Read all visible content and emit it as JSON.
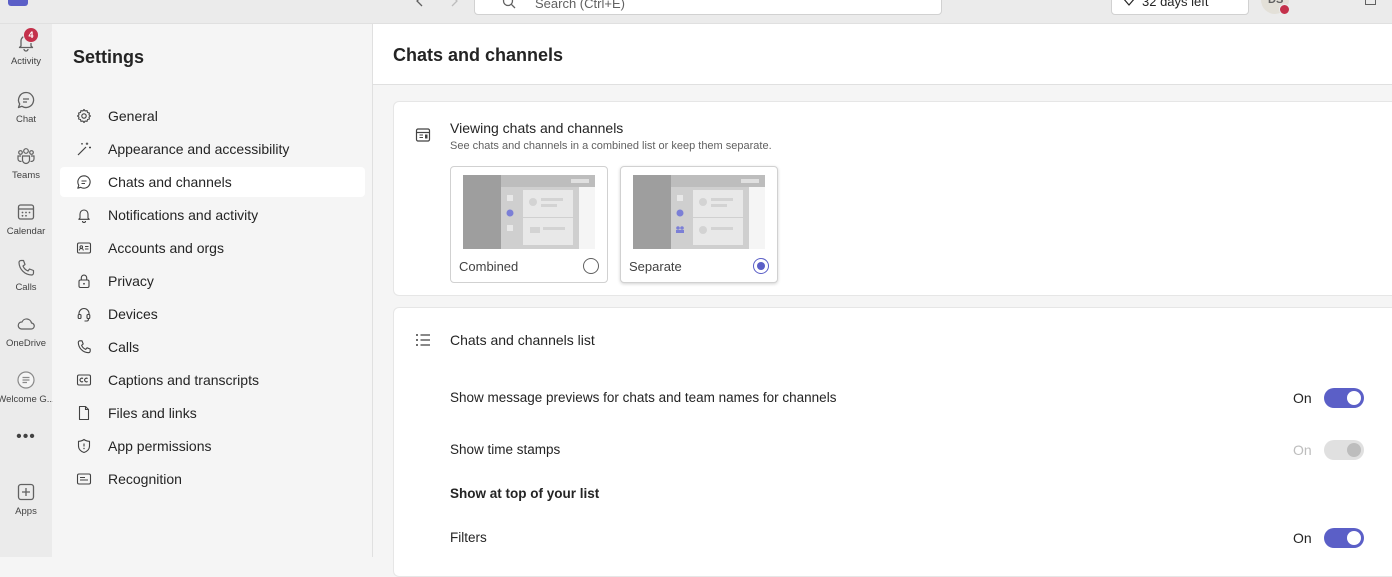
{
  "topbar": {
    "search_placeholder": "Search (Ctrl+E)",
    "trial_label": "32 days left",
    "more_label": "···",
    "avatar_initials": "DS"
  },
  "rail": {
    "items": [
      {
        "label": "Activity",
        "icon": "bell-icon",
        "badge": "4"
      },
      {
        "label": "Chat",
        "icon": "chat-icon"
      },
      {
        "label": "Teams",
        "icon": "teams-icon"
      },
      {
        "label": "Calendar",
        "icon": "calendar-icon"
      },
      {
        "label": "Calls",
        "icon": "phone-icon"
      },
      {
        "label": "OneDrive",
        "icon": "cloud-icon"
      },
      {
        "label": "Welcome G...",
        "icon": "welcome-icon"
      }
    ],
    "more_label": "•••",
    "apps_label": "Apps"
  },
  "settings": {
    "title": "Settings",
    "nav": [
      {
        "label": "General",
        "icon": "gear-icon"
      },
      {
        "label": "Appearance and accessibility",
        "icon": "wand-icon"
      },
      {
        "label": "Chats and channels",
        "icon": "chat-icon",
        "active": true
      },
      {
        "label": "Notifications and activity",
        "icon": "bell-icon"
      },
      {
        "label": "Accounts and orgs",
        "icon": "contact-card-icon"
      },
      {
        "label": "Privacy",
        "icon": "lock-icon"
      },
      {
        "label": "Devices",
        "icon": "headset-icon"
      },
      {
        "label": "Calls",
        "icon": "phone-icon"
      },
      {
        "label": "Captions and transcripts",
        "icon": "closed-caption-icon"
      },
      {
        "label": "Files and links",
        "icon": "document-icon"
      },
      {
        "label": "App permissions",
        "icon": "shield-icon"
      },
      {
        "label": "Recognition",
        "icon": "recognition-icon"
      }
    ]
  },
  "main": {
    "title": "Chats and channels",
    "viewing": {
      "heading": "Viewing chats and channels",
      "subtitle": "See chats and channels in a combined list or keep them separate.",
      "options": [
        {
          "label": "Combined",
          "selected": false
        },
        {
          "label": "Separate",
          "selected": true
        }
      ]
    },
    "list": {
      "heading": "Chats and channels list",
      "rows": [
        {
          "label": "Show message previews for chats and team names for channels",
          "state": "On",
          "enabled": true
        },
        {
          "label": "Show time stamps",
          "state": "On",
          "enabled": false
        }
      ],
      "section_label": "Show at top of your list",
      "filters": {
        "label": "Filters",
        "state": "On",
        "enabled": true
      }
    }
  },
  "colors": {
    "accent": "#5b5fc7",
    "badge": "#c4314b",
    "rail_bg": "#ebebeb",
    "page_bg": "#f5f5f5"
  }
}
